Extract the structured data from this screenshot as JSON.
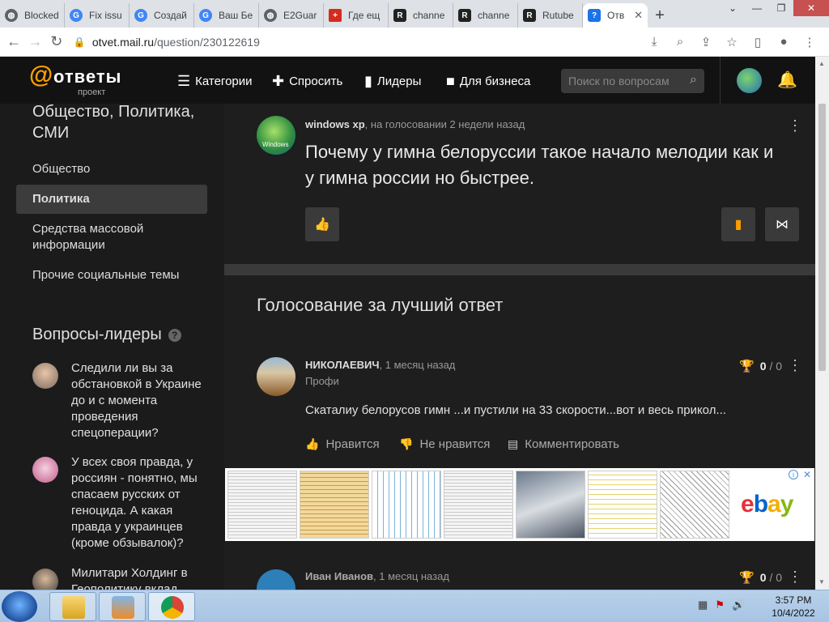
{
  "browser": {
    "tabs": [
      {
        "label": "Blocked",
        "icon": "globe-icon",
        "color": "#5f6368"
      },
      {
        "label": "Fix issu",
        "icon": "google-icon",
        "color": "#4285f4"
      },
      {
        "label": "Создай",
        "icon": "google-icon",
        "color": "#4285f4"
      },
      {
        "label": "Ваш Бе",
        "icon": "google-icon",
        "color": "#4285f4"
      },
      {
        "label": "E2Guar",
        "icon": "globe-icon",
        "color": "#5f6368"
      },
      {
        "label": "Где ещ",
        "icon": "swiss-icon",
        "color": "#d52b1e"
      },
      {
        "label": "channe",
        "icon": "rutube-icon",
        "color": "#222222"
      },
      {
        "label": "channe",
        "icon": "rutube-icon",
        "color": "#222222"
      },
      {
        "label": "Rutube",
        "icon": "rutube-icon",
        "color": "#222222"
      },
      {
        "label": "Отв",
        "icon": "question-icon",
        "color": "#1a73e8"
      }
    ],
    "url_host": "otvet.mail.ru",
    "url_path": "/question/230122619"
  },
  "header": {
    "logo_text": "ответы",
    "logo_sub": "проект",
    "nav": [
      {
        "label": "Категории",
        "icon": "list-icon"
      },
      {
        "label": "Спросить",
        "icon": "plus-icon"
      },
      {
        "label": "Лидеры",
        "icon": "bars-icon"
      },
      {
        "label": "Для бизнеса",
        "icon": "briefcase-icon"
      }
    ],
    "search_placeholder": "Поиск по вопросам"
  },
  "sidebar": {
    "category_title": "Общество, Политика, СМИ",
    "subcategories": [
      "Общество",
      "Политика",
      "Средства массовой информации",
      "Прочие социальные темы"
    ],
    "active_index": 1,
    "leaders_title": "Вопросы-лидеры",
    "leader_questions": [
      "Следили ли вы за обстановкой в Украине до и с момента проведения спецоперации?",
      "У всех своя правда, у россиян - понятно, мы спасаем русских от геноцида. А какая правда у украинцев (кроме обзывалок)?",
      "Милитари Холдинг в Геополитику вклад"
    ]
  },
  "question": {
    "author": "windows xp",
    "meta": ", на голосовании 2 недели назад",
    "avatar_caption": "Windows",
    "title": "Почему у гимна белоруссии такое начало мелодии как и у гимна россии но быстрее.",
    "accent_color": "#ff9e00"
  },
  "answers": {
    "heading": "Голосование за лучший ответ",
    "items": [
      {
        "author": "НИКОЛАЕВИЧ",
        "meta": ", 1 месяц назад",
        "rank": "Профи",
        "text": "Скаталиу белорусов гимн ...и пустили на 33 скорости...вот и весь прикол...",
        "votes": "0",
        "votes_total": "/ 0",
        "actions": [
          "Нравится",
          "Не нравится",
          "Комментировать"
        ]
      },
      {
        "author": "Иван Иванов",
        "meta": ", 1 месяц назад",
        "votes": "0",
        "votes_total": "/ 0"
      }
    ]
  },
  "ad": {
    "brand_e": "e",
    "brand_b": "b",
    "brand_a": "a",
    "brand_y": "y"
  },
  "taskbar": {
    "time": "3:57 PM",
    "date": "10/4/2022"
  }
}
